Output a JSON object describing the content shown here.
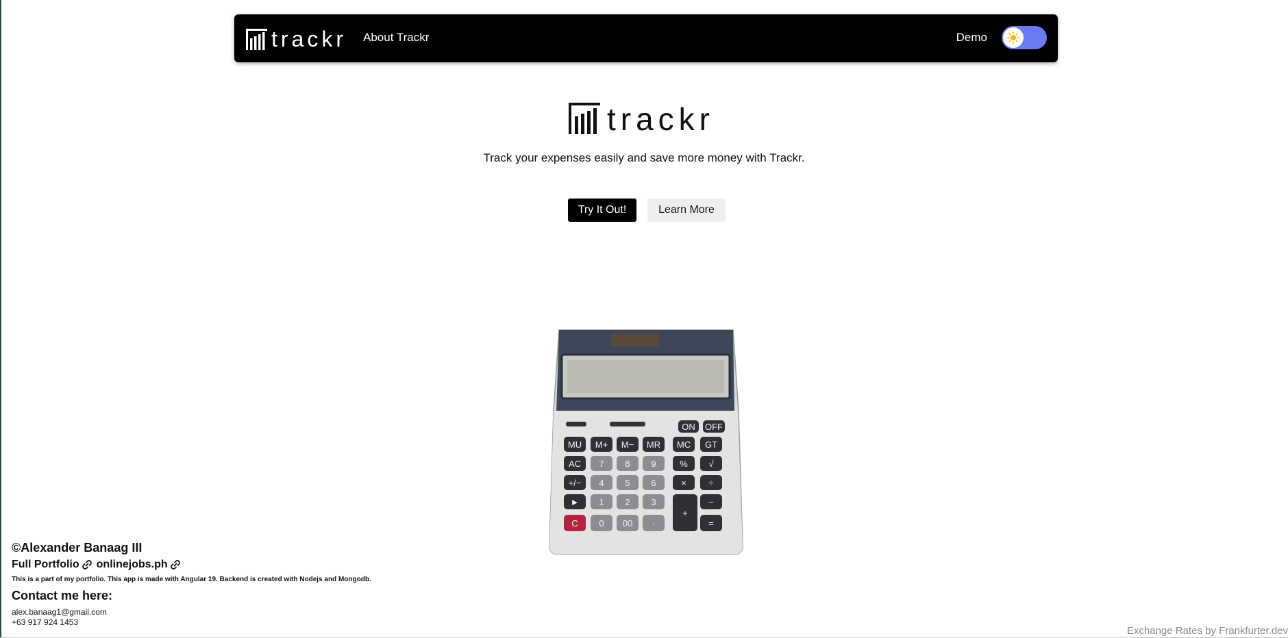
{
  "navbar": {
    "brand": "trackr",
    "about_link": "About Trackr",
    "demo_label": "Demo",
    "theme_toggle_icon": "sun-icon"
  },
  "hero": {
    "brand": "trackr",
    "tagline": "Track your expenses easily and save more money with Trackr.",
    "primary_button": "Try It Out!",
    "secondary_button": "Learn More"
  },
  "calculator": {
    "keys_top": [
      "ON",
      "OFF"
    ],
    "row1": [
      "MU",
      "M+",
      "M−",
      "MR",
      "MC",
      "GT"
    ],
    "row2": [
      "AC",
      "7",
      "8",
      "9",
      "%",
      "√"
    ],
    "row3": [
      "+/−",
      "4",
      "5",
      "6",
      "×",
      "÷"
    ],
    "row4": [
      "►",
      "1",
      "2",
      "3",
      "+",
      "−"
    ],
    "row5": [
      "C",
      "0",
      "00",
      "·",
      "="
    ]
  },
  "footer": {
    "copyright": "©Alexander Banaag III",
    "portfolio_link": "Full Portfolio",
    "onlinejobs_link": "onlinejobs.ph",
    "note": "This is a part of my portfolio. This app is made with Angular 19. Backend is created with Nodejs and Mongodb.",
    "contact_title": "Contact me here:",
    "email": "alex.banaag1@gmail.com",
    "phone": "+63 917 924 1453"
  },
  "credit": "Exchange Rates by Frankfurter.dev",
  "colors": {
    "navbar_bg": "#000000",
    "toggle_bg": "#6b7cf3",
    "sun": "#f5b800"
  }
}
